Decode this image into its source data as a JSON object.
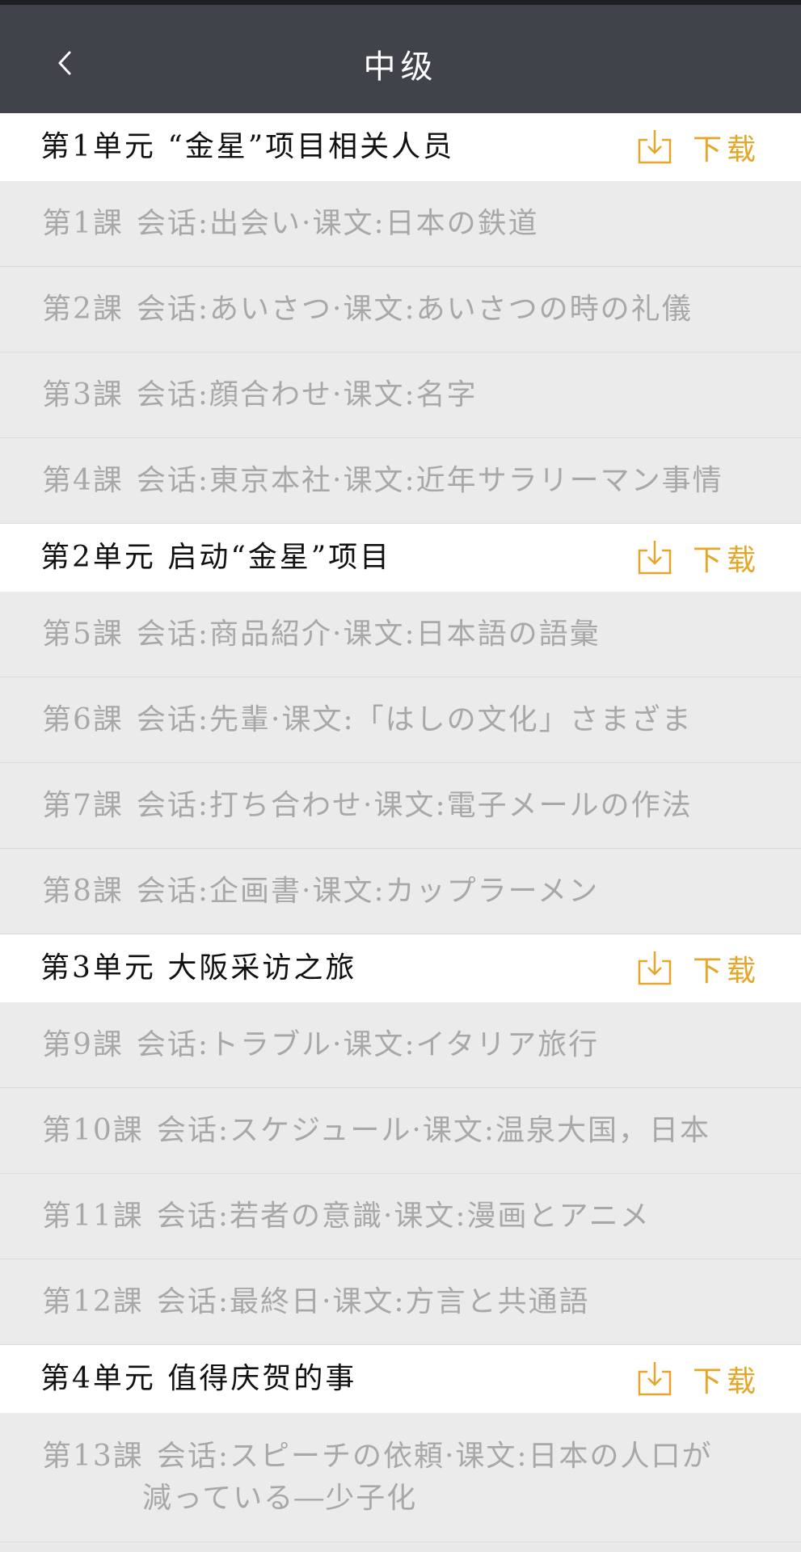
{
  "header": {
    "title": "中级"
  },
  "download_label": "下载",
  "units": [
    {
      "title": "第1单元 “金星”项目相关人员",
      "lessons": [
        {
          "num": "第1課",
          "text": "会话:出会い·课文:日本の鉄道"
        },
        {
          "num": "第2課",
          "text": "会话:あいさつ·课文:あいさつの時の礼儀"
        },
        {
          "num": "第3課",
          "text": "会话:顔合わせ·课文:名字"
        },
        {
          "num": "第4課",
          "text": "会话:東京本社·课文:近年サラリーマン事情"
        }
      ]
    },
    {
      "title": "第2单元  启动“金星”项目",
      "lessons": [
        {
          "num": "第5課",
          "text": "会话:商品紹介·课文:日本語の語彙"
        },
        {
          "num": "第6課",
          "text": "会话:先輩·课文:「はしの文化」さまざま"
        },
        {
          "num": "第7課",
          "text": "会话:打ち合わせ·课文:電子メールの作法"
        },
        {
          "num": "第8課",
          "text": "会话:企画書·课文:カップラーメン"
        }
      ]
    },
    {
      "title": "第3单元  大阪采访之旅",
      "lessons": [
        {
          "num": "第9課",
          "text": "会话:トラブル·课文:イタリア旅行"
        },
        {
          "num": "第10課",
          "text": "会话:スケジュール·课文:温泉大国，日本"
        },
        {
          "num": "第11課",
          "text": "会话:若者の意識·课文:漫画とアニメ"
        },
        {
          "num": "第12課",
          "text": "会话:最終日·课文:方言と共通語"
        }
      ]
    },
    {
      "title": "第4单元  值得庆贺的事",
      "lessons": [
        {
          "num": "第13課",
          "text": "会话:スピーチの依頼·课文:日本の人口が",
          "text2": "減っている―少子化"
        }
      ]
    }
  ]
}
